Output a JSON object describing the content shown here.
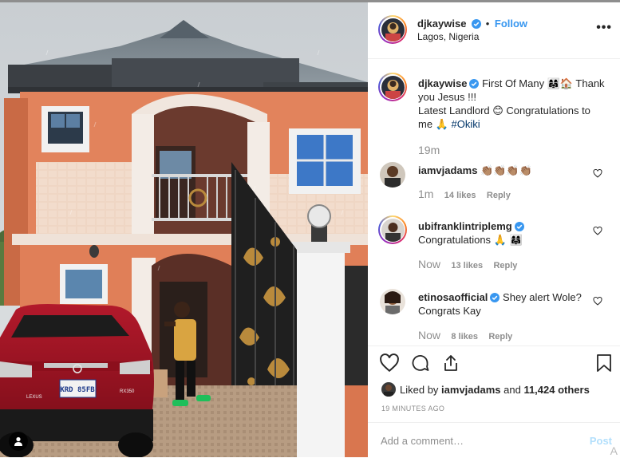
{
  "photo": {
    "plate_text": "KRD 85FB",
    "brand_text": "LEXUS",
    "model_text": "RX350"
  },
  "post": {
    "username": "djkaywise",
    "follow_label": "Follow",
    "location": "Lagos, Nigeria",
    "more_label": "•••",
    "caption": {
      "username": "djkaywise",
      "line1": "First Of Many 👩‍👩‍👧🏠 Thank you Jesus !!!",
      "line2": "Latest Landlord 😊 Congratulations to me 🙏",
      "hashtag": "#Okiki",
      "time": "19m"
    },
    "comments": [
      {
        "username": "iamvjadams",
        "text": "👏🏽👏🏽👏🏽👏🏽",
        "time": "1m",
        "likes": "14 likes",
        "reply": "Reply"
      },
      {
        "username": "ubifranklintriplemg",
        "text": "Congratulations 🙏 👩‍👩‍👧",
        "time": "Now",
        "likes": "13 likes",
        "reply": "Reply"
      },
      {
        "username": "etinosaofficial",
        "text": "Shey alert Wole? Congrats Kay",
        "time": "Now",
        "likes": "8 likes",
        "reply": "Reply"
      }
    ],
    "liked_by_prefix": "Liked by",
    "liked_by_user": "iamvjadams",
    "liked_by_and": "and",
    "liked_by_count": "11,424 others",
    "timestamp": "19 MINUTES AGO",
    "add_comment_placeholder": "Add a comment…",
    "post_label": "Post",
    "corner_glyph": "A"
  },
  "colors": {
    "follow": "#3897f0",
    "verified": "#3897f0",
    "post_disabled": "#b2dffc",
    "muted": "#8e8e8e"
  },
  "icons": [
    "heart-icon",
    "comment-icon",
    "share-icon",
    "bookmark-icon",
    "verified-icon",
    "user-tag-icon",
    "more-icon"
  ]
}
